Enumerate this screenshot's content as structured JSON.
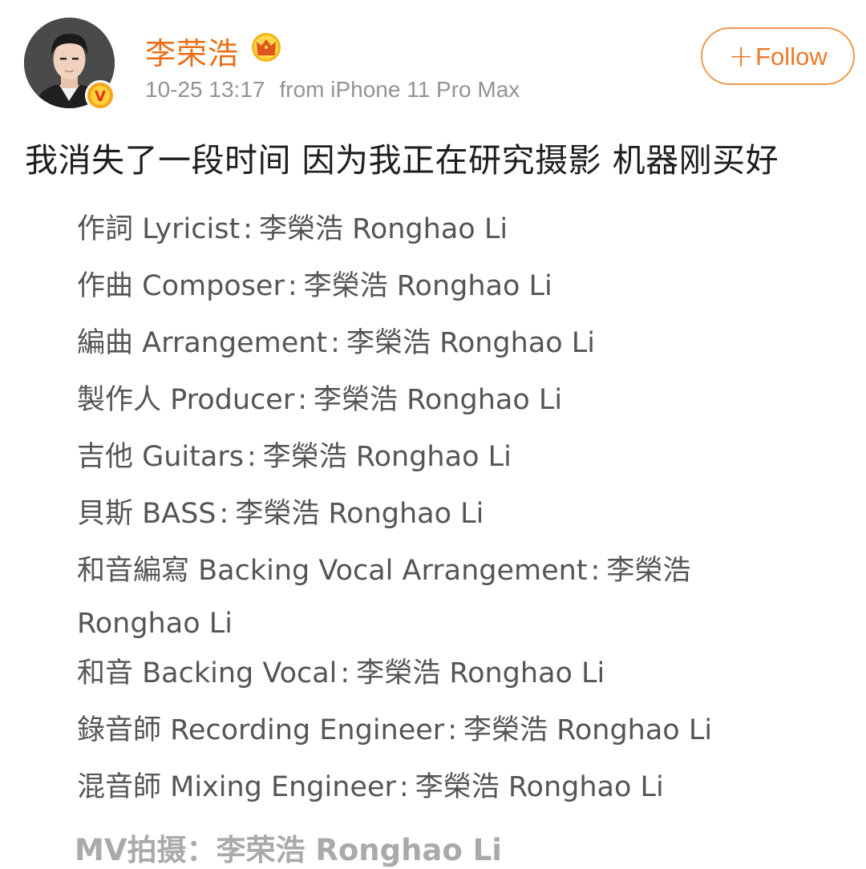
{
  "header": {
    "user_name": "李荣浩",
    "timestamp": "10-25 13:17",
    "source": "from iPhone 11 Pro Max",
    "follow_label": "Follow"
  },
  "post": {
    "text": "我消失了一段时间 因为我正在研究摄影 机器刚买好",
    "credits": [
      {
        "role": "作詞 Lyricist",
        "name": "李榮浩 Ronghao Li"
      },
      {
        "role": "作曲 Composer",
        "name": "李榮浩 Ronghao Li"
      },
      {
        "role": "編曲 Arrangement",
        "name": "李榮浩 Ronghao Li"
      },
      {
        "role": "製作人 Producer",
        "name": "李榮浩 Ronghao Li"
      },
      {
        "role": "吉他 Guitars",
        "name": "李榮浩 Ronghao Li"
      },
      {
        "role": "貝斯 BASS",
        "name": "李榮浩 Ronghao Li"
      },
      {
        "role": "和音編寫 Backing Vocal Arrangement",
        "name": "李榮浩 Ronghao Li"
      },
      {
        "role": "和音 Backing Vocal",
        "name": "李榮浩 Ronghao Li"
      },
      {
        "role": "錄音師 Recording Engineer",
        "name": "李榮浩 Ronghao Li"
      },
      {
        "role": "混音師 Mixing Engineer",
        "name": "李榮浩 Ronghao Li"
      }
    ],
    "faded_line": "MV拍摄：李荣浩 Ronghao Li"
  },
  "colors": {
    "accent": "#ea6f1a",
    "follow_border": "#ef9a4d",
    "meta_text": "#939393",
    "body_text": "#1e1e1e",
    "credit_text": "#555555"
  },
  "icons": {
    "avatar": "user-avatar-photo",
    "badge": "verified-v-icon",
    "crown": "crown-icon"
  }
}
